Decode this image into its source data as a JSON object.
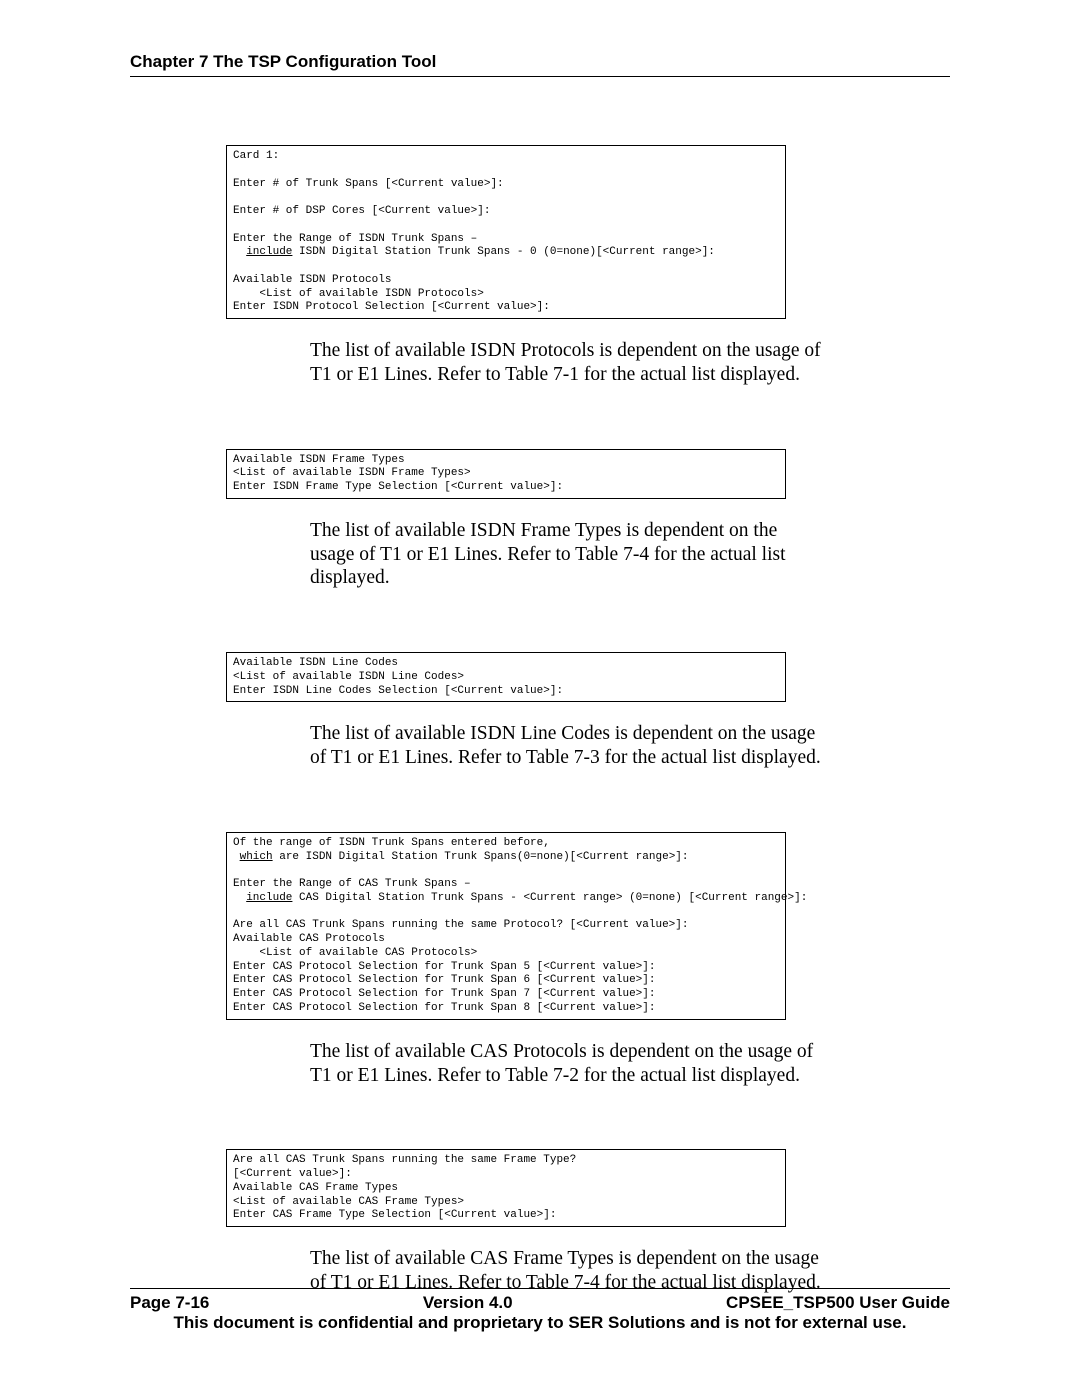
{
  "header": {
    "chapter": "Chapter 7 The TSP Configuration Tool"
  },
  "blocks": [
    {
      "code": "Card 1:\n\nEnter # of Trunk Spans [<Current value>]:\n\nEnter # of DSP Cores [<Current value>]:\n\nEnter the Range of ISDN Trunk Spans –\n  <u>include</u> ISDN Digital Station Trunk Spans - 0 (0=none)[<Current range>]:\n\nAvailable ISDN Protocols\n    <List of available ISDN Protocols>\nEnter ISDN Protocol Selection [<Current value>]:",
      "para": "The list of available ISDN Protocols is dependent on the usage of T1 or E1 Lines.  Refer to Table 7-1 for the actual list displayed."
    },
    {
      "code": "Available ISDN Frame Types\n<List of available ISDN Frame Types>\nEnter ISDN Frame Type Selection [<Current value>]:",
      "para": "The list of available ISDN Frame Types is dependent on the usage of T1 or E1 Lines.  Refer to Table 7-4 for the actual list displayed."
    },
    {
      "code": "Available ISDN Line Codes\n<List of available ISDN Line Codes>\nEnter ISDN Line Codes Selection [<Current value>]:",
      "para": "The list of available ISDN Line Codes is dependent on the usage of T1 or E1 Lines.  Refer to Table 7-3 for the actual list displayed."
    },
    {
      "code": "Of the range of ISDN Trunk Spans entered before,\n <u>which</u> are ISDN Digital Station Trunk Spans(0=none)[<Current range>]:\n\nEnter the Range of CAS Trunk Spans –\n  <u>include</u> CAS Digital Station Trunk Spans - <Current range> (0=none) [<Current range>]:\n\nAre all CAS Trunk Spans running the same Protocol? [<Current value>]:\nAvailable CAS Protocols\n    <List of available CAS Protocols>\nEnter CAS Protocol Selection for Trunk Span 5 [<Current value>]:\nEnter CAS Protocol Selection for Trunk Span 6 [<Current value>]:\nEnter CAS Protocol Selection for Trunk Span 7 [<Current value>]:\nEnter CAS Protocol Selection for Trunk Span 8 [<Current value>]:",
      "para": "The list of available CAS Protocols is dependent on the usage of T1 or E1 Lines.  Refer to Table 7-2 for the actual list displayed."
    },
    {
      "code": "Are all CAS Trunk Spans running the same Frame Type?\n[<Current value>]:\nAvailable CAS Frame Types\n<List of available CAS Frame Types>\nEnter CAS Frame Type Selection [<Current value>]:",
      "para": "The list of available CAS Frame Types is dependent on the usage of T1 or E1 Lines. Refer to Table 7-4 for the actual list displayed."
    }
  ],
  "footer": {
    "page": "Page 7-16",
    "version": "Version 4.0",
    "guide": "CPSEE_TSP500 User Guide",
    "confidential": "This document is confidential and proprietary to SER Solutions and is not for external use."
  }
}
